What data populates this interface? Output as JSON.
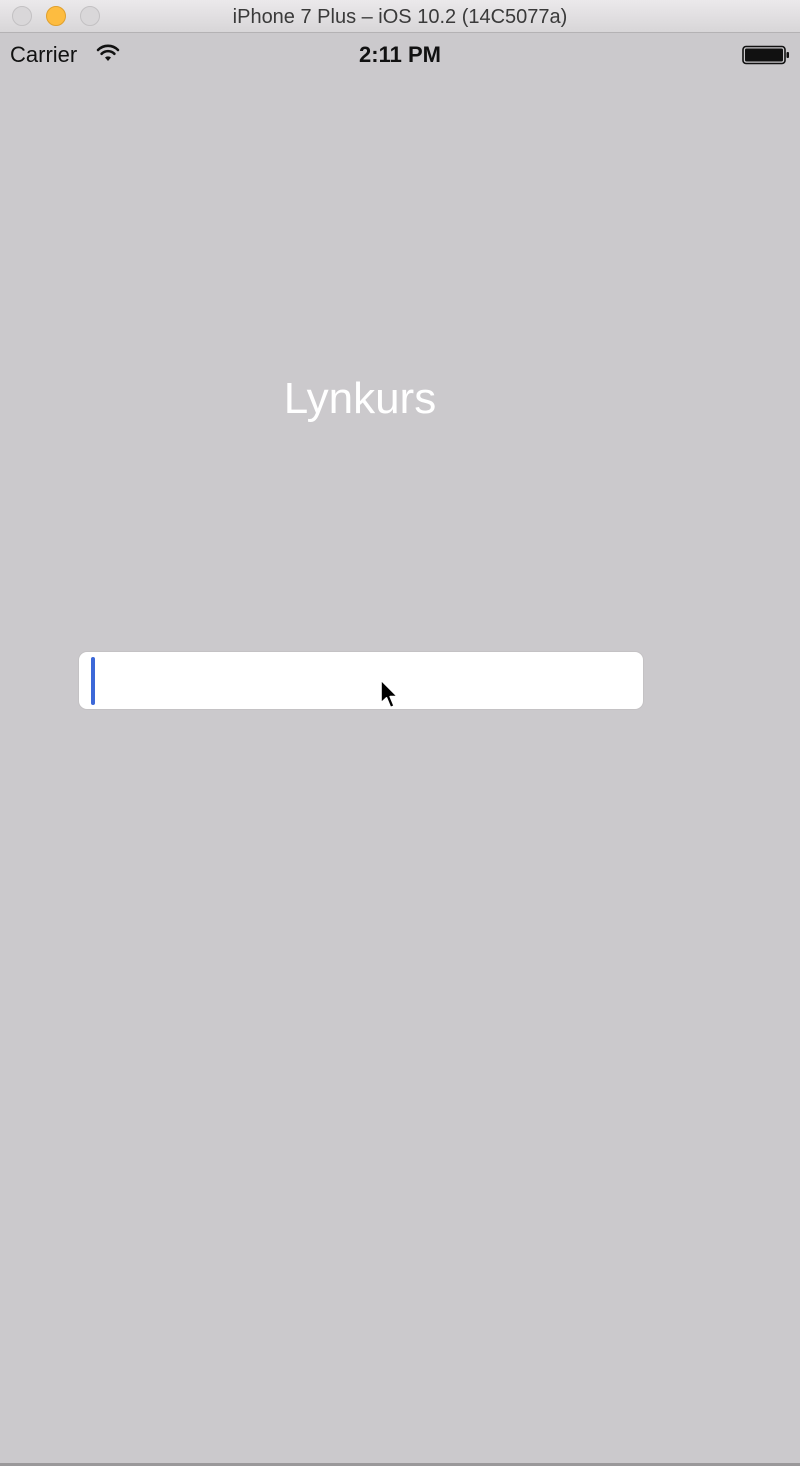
{
  "window": {
    "title": "iPhone 7 Plus – iOS 10.2 (14C5077a)"
  },
  "status_bar": {
    "carrier": "Carrier",
    "time": "2:11 PM",
    "wifi_icon": "wifi-icon",
    "battery_icon": "battery-icon",
    "battery_level": 1.0
  },
  "main": {
    "title": "Lynkurs",
    "input": {
      "value": "",
      "placeholder": ""
    }
  },
  "colors": {
    "background": "#cbc9cc",
    "title_text": "#ffffff",
    "caret": "#3c68d8",
    "minimize_button": "#fdbc40"
  }
}
